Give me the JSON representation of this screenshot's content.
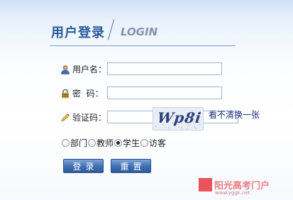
{
  "header": {
    "title": "用户登录",
    "subtitle": "LOGIN"
  },
  "form": {
    "username": {
      "label": "用户名：",
      "value": "",
      "icon": "user-icon"
    },
    "password": {
      "label": "密  码：",
      "value": "",
      "icon": "lock-icon"
    },
    "captcha": {
      "label": "验证码：",
      "value": "",
      "icon": "pencil-icon",
      "image_text": "Wp8i",
      "refresh_label": "看不清换一张"
    },
    "roles": [
      {
        "label": "部门",
        "checked": false
      },
      {
        "label": "教师",
        "checked": false
      },
      {
        "label": "学生",
        "checked": true
      },
      {
        "label": "访客",
        "checked": false
      }
    ],
    "login_button": "登录",
    "reset_button": "重置"
  },
  "watermark": {
    "name": "阳光高考门户",
    "url": "www.yggk.net"
  },
  "colors": {
    "accent": "#2a5a9c",
    "button": "#3e6fb3",
    "watermark": "#e8545a"
  }
}
